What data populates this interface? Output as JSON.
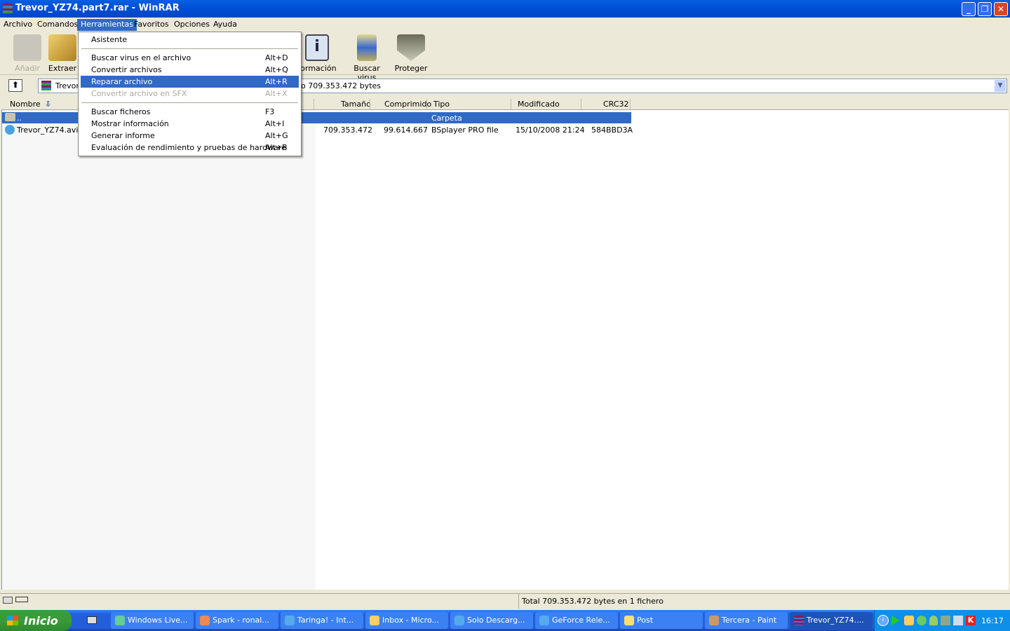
{
  "window": {
    "title": "Trevor_YZ74.part7.rar - WinRAR"
  },
  "menubar": [
    "Archivo",
    "Comandos",
    "Herramientas",
    "Favoritos",
    "Opciones",
    "Ayuda"
  ],
  "toolbar": {
    "add": "Añadir",
    "extract": "Extraer",
    "info": "formación",
    "scan": "Buscar virus",
    "protect": "Proteger"
  },
  "address": {
    "left": "Trevor",
    "right": "o 709.353.472 bytes"
  },
  "columns": {
    "name": "Nombre",
    "size": "Tamaño",
    "packed": "Comprimido",
    "type": "Tipo",
    "modified": "Modificado",
    "crc": "CRC32"
  },
  "rows": [
    {
      "name": "..",
      "size": "",
      "packed": "",
      "type": "Carpeta",
      "modified": "",
      "crc": ""
    },
    {
      "name": "Trevor_YZ74.avi",
      "size": "709.353.472",
      "packed": "99.614.667",
      "type": "BSplayer PRO file",
      "modified": "15/10/2008 21:24",
      "crc": "584BBD3A"
    }
  ],
  "menu": {
    "items": [
      {
        "label": "Asistente",
        "key": ""
      },
      {
        "label": "Buscar virus en el archivo",
        "key": "Alt+D"
      },
      {
        "label": "Convertir archivos",
        "key": "Alt+Q"
      },
      {
        "label": "Reparar archivo",
        "key": "Alt+R"
      },
      {
        "label": "Convertir archivo en SFX",
        "key": "Alt+X"
      },
      {
        "label": "Buscar ficheros",
        "key": "F3"
      },
      {
        "label": "Mostrar información",
        "key": "Alt+I"
      },
      {
        "label": "Generar informe",
        "key": "Alt+G"
      },
      {
        "label": "Evaluación de rendimiento y pruebas de hardware",
        "key": "Alt+B"
      }
    ]
  },
  "status": {
    "text": "Total 709.353.472 bytes en 1 fichero"
  },
  "taskbar": {
    "start": "Inicio",
    "tasks": [
      "Windows Live...",
      "Spark - ronal...",
      "Taringa! - Int...",
      "Inbox - Micro...",
      "Solo Descarg...",
      "GeForce Rele...",
      "Post",
      "Tercera - Paint",
      "Trevor_YZ74...."
    ],
    "clock": "16:17"
  }
}
